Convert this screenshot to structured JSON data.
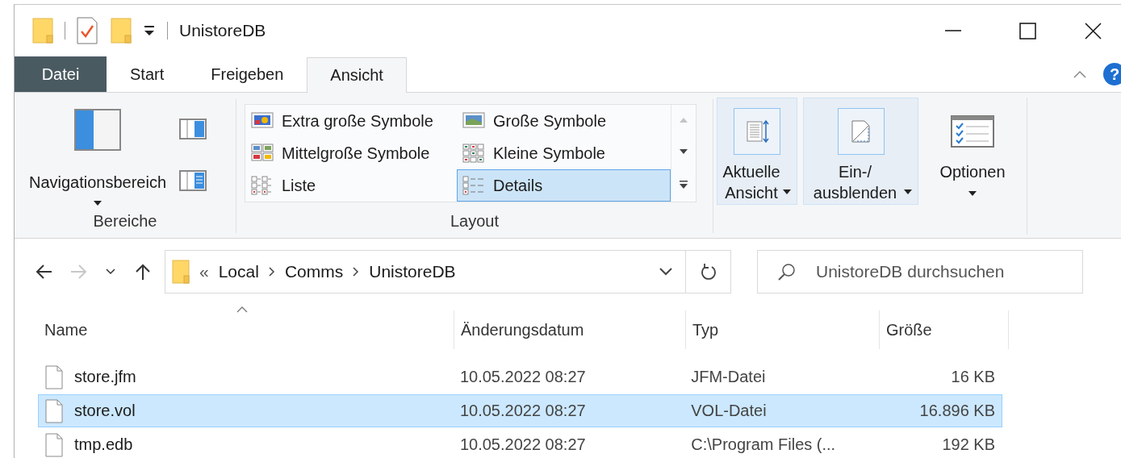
{
  "title_bar": {
    "title": "UnistoreDB"
  },
  "tabs": [
    {
      "label": "Datei",
      "kind": "menu",
      "selected": false
    },
    {
      "label": "Start",
      "kind": "tab",
      "selected": false
    },
    {
      "label": "Freigeben",
      "kind": "tab",
      "selected": false
    },
    {
      "label": "Ansicht",
      "kind": "tab",
      "selected": true
    }
  ],
  "help_button": "?",
  "ribbon": {
    "panes": {
      "label": "Bereiche",
      "navigation_pane": "Navigationsbereich"
    },
    "layout": {
      "label": "Layout",
      "options": [
        {
          "label": "Extra große Symbole",
          "kind": "xlarge",
          "selected": false
        },
        {
          "label": "Große Symbole",
          "kind": "large",
          "selected": false
        },
        {
          "label": "Mittelgroße Symbole",
          "kind": "medium",
          "selected": false
        },
        {
          "label": "Kleine Symbole",
          "kind": "small",
          "selected": false
        },
        {
          "label": "Liste",
          "kind": "list",
          "selected": false
        },
        {
          "label": "Details",
          "kind": "details",
          "selected": true
        }
      ]
    },
    "buttons": [
      {
        "label": "Aktuelle Ansicht",
        "kind": "sort",
        "highlighted": true
      },
      {
        "label": "Ein-/ ausblenden",
        "kind": "showhide",
        "highlighted": true
      },
      {
        "label": "Optionen",
        "kind": "options",
        "highlighted": false
      }
    ]
  },
  "navigation": [
    {
      "kind": "back",
      "disabled": false
    },
    {
      "kind": "forward",
      "disabled": true
    },
    {
      "kind": "recent",
      "disabled": false
    },
    {
      "kind": "up",
      "disabled": false
    }
  ],
  "address_bar": {
    "overflow": "«",
    "path": [
      "Local",
      "Comms",
      "UnistoreDB"
    ]
  },
  "search": {
    "placeholder": "UnistoreDB durchsuchen"
  },
  "table": {
    "columns": [
      {
        "label": "Name",
        "sorted": true
      },
      {
        "label": "Änderungsdatum",
        "sorted": false
      },
      {
        "label": "Typ",
        "sorted": false
      },
      {
        "label": "Größe",
        "sorted": false
      }
    ],
    "rows": [
      {
        "name": "store.jfm",
        "modified": "10.05.2022 08:27",
        "type": "JFM-Datei",
        "size": "16 KB",
        "selected": false
      },
      {
        "name": "store.vol",
        "modified": "10.05.2022 08:27",
        "type": "VOL-Datei",
        "size": "16.896 KB",
        "selected": true
      },
      {
        "name": "tmp.edb",
        "modified": "10.05.2022 08:27",
        "type": "C:\\Program Files (...",
        "size": "192 KB",
        "selected": false
      }
    ]
  }
}
